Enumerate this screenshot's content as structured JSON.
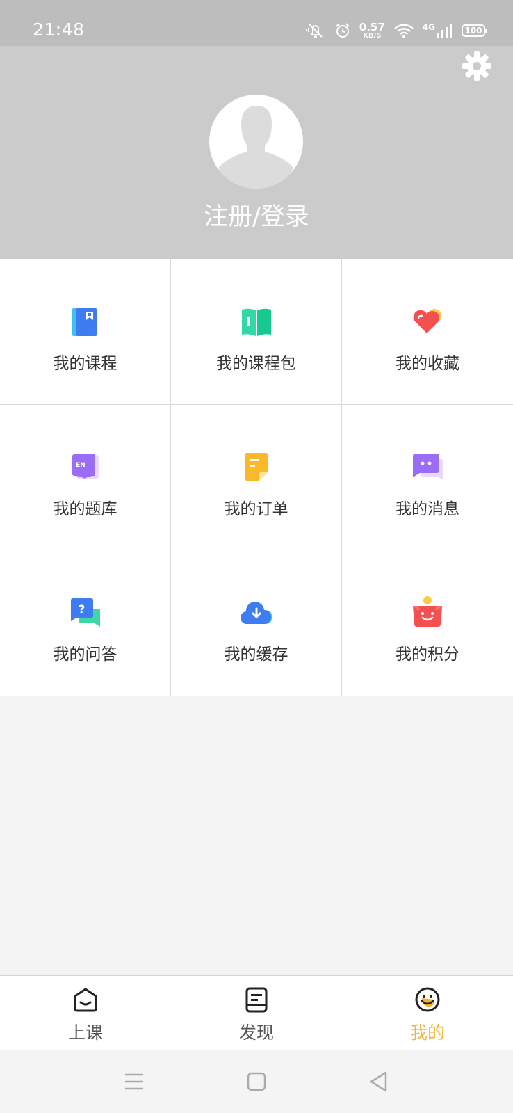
{
  "status_bar": {
    "time": "21:48",
    "net_speed_value": "0.57",
    "net_speed_unit": "KB/S",
    "network": "4G",
    "battery": "100"
  },
  "header": {
    "login_text": "注册/登录"
  },
  "menu": [
    {
      "label": "我的课程",
      "icon": "course-book-icon"
    },
    {
      "label": "我的课程包",
      "icon": "course-package-icon"
    },
    {
      "label": "我的收藏",
      "icon": "favorite-heart-icon"
    },
    {
      "label": "我的题库",
      "icon": "question-bank-icon"
    },
    {
      "label": "我的订单",
      "icon": "order-note-icon"
    },
    {
      "label": "我的消息",
      "icon": "message-bubble-icon"
    },
    {
      "label": "我的问答",
      "icon": "qa-bubble-icon"
    },
    {
      "label": "我的缓存",
      "icon": "cloud-download-icon"
    },
    {
      "label": "我的积分",
      "icon": "points-basket-icon"
    }
  ],
  "tabs": [
    {
      "label": "上课",
      "icon": "class-house-icon"
    },
    {
      "label": "发现",
      "icon": "discover-note-icon"
    },
    {
      "label": "我的",
      "icon": "smiley-face-icon",
      "active": true
    }
  ],
  "colors": {
    "accent": "#f5b335",
    "header_bg": "#cbcbcb",
    "status_bg": "#bdbdbd"
  }
}
